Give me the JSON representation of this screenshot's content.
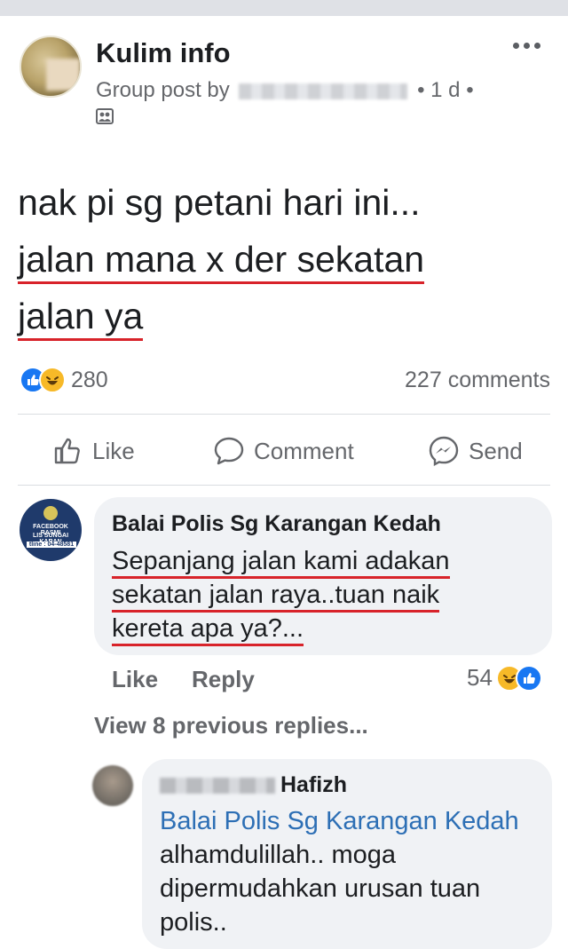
{
  "post": {
    "group_name": "Kulim info",
    "meta_prefix": "Group post by",
    "meta_suffix": "• 1 d •",
    "text_lines": [
      "nak pi sg petani hari ini...",
      "jalan mana x der sekatan",
      "jalan ya"
    ],
    "reaction_count": "280",
    "comments_count": "227 comments"
  },
  "actions": {
    "like": "Like",
    "comment": "Comment",
    "send": "Send"
  },
  "comment1": {
    "author": "Balai Polis Sg Karangan Kedah",
    "avatar_lines": [
      "FACEBOOK RASMI",
      "LIS SUNGAI KARAN",
      "tline : 04-48581"
    ],
    "text_lines": [
      "Sepanjang jalan kami adakan",
      "sekatan jalan raya..tuan naik",
      "kereta apa ya?..."
    ],
    "like_label": "Like",
    "reply_label": "Reply",
    "reaction_count": "54"
  },
  "view_previous": "View 8 previous replies...",
  "comment2": {
    "author_visible": "Hafizh",
    "mention": "Balai Polis Sg Karangan Kedah",
    "text": "alhamdulillah.. moga dipermudahkan urusan tuan polis.."
  },
  "colors": {
    "underline": "#d8232a",
    "like_blue": "#1877f2",
    "haha_yellow": "#f7b928",
    "mention_blue": "#2d6fb5"
  }
}
